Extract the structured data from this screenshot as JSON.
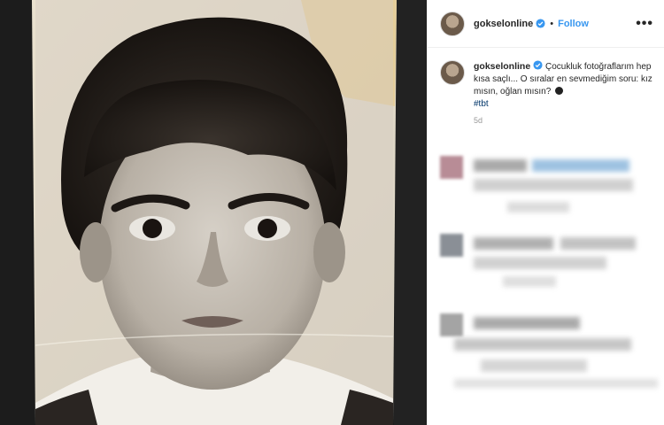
{
  "post": {
    "username": "gokselonline",
    "follow_label": "Follow",
    "more_label": "•••",
    "separator": "•"
  },
  "caption": {
    "username": "gokselonline",
    "text": "Çocukluk fotoğraflarım hep kısa saçlı... O sıralar en sevmediğim soru: kız mısın, oğlan mısın?",
    "hashtag": "#tbt",
    "time_ago": "5d"
  },
  "colors": {
    "accent": "#3897f0",
    "verified": "#3897f0",
    "hashtag": "#003569"
  },
  "icons": {
    "verified": "verified-badge-icon",
    "more": "more-options-icon",
    "emoji": "face-emoji-icon"
  }
}
